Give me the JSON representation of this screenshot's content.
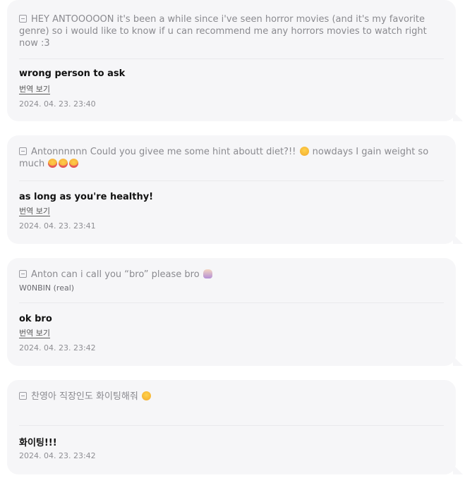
{
  "cards": [
    {
      "question": "HEY ANTOOOOON it's been a while since i've seen horror movies (and it's my favorite genre) so i would like to know if u can recommend me any horrors movies to watch right now :3",
      "answer": "wrong person to ask",
      "translate": "번역 보기",
      "time": "2024. 04. 23. 23:40"
    },
    {
      "question_part1": "Antonnnnnn Could you givee me some hint aboutt diet?!!",
      "question_part2": "nowdays I gain weight so much",
      "emoji1": "pleading-face-icon",
      "emoji2": "crying-face-icon",
      "answer": "as long as you're healthy!",
      "translate": "번역 보기",
      "time": "2024. 04. 23. 23:41"
    },
    {
      "question": "Anton can i call you “bro” please bro",
      "emoji": "pleading-hands-icon",
      "author": "W0NBIN (real)",
      "answer": "ok bro",
      "translate": "번역 보기",
      "time": "2024. 04. 23. 23:42"
    },
    {
      "question": "찬영아 직장인도 화이팅해줘",
      "emoji": "pleading-face-icon",
      "answer": "화이팅!!!",
      "time": "2024. 04. 23. 23:42"
    }
  ]
}
